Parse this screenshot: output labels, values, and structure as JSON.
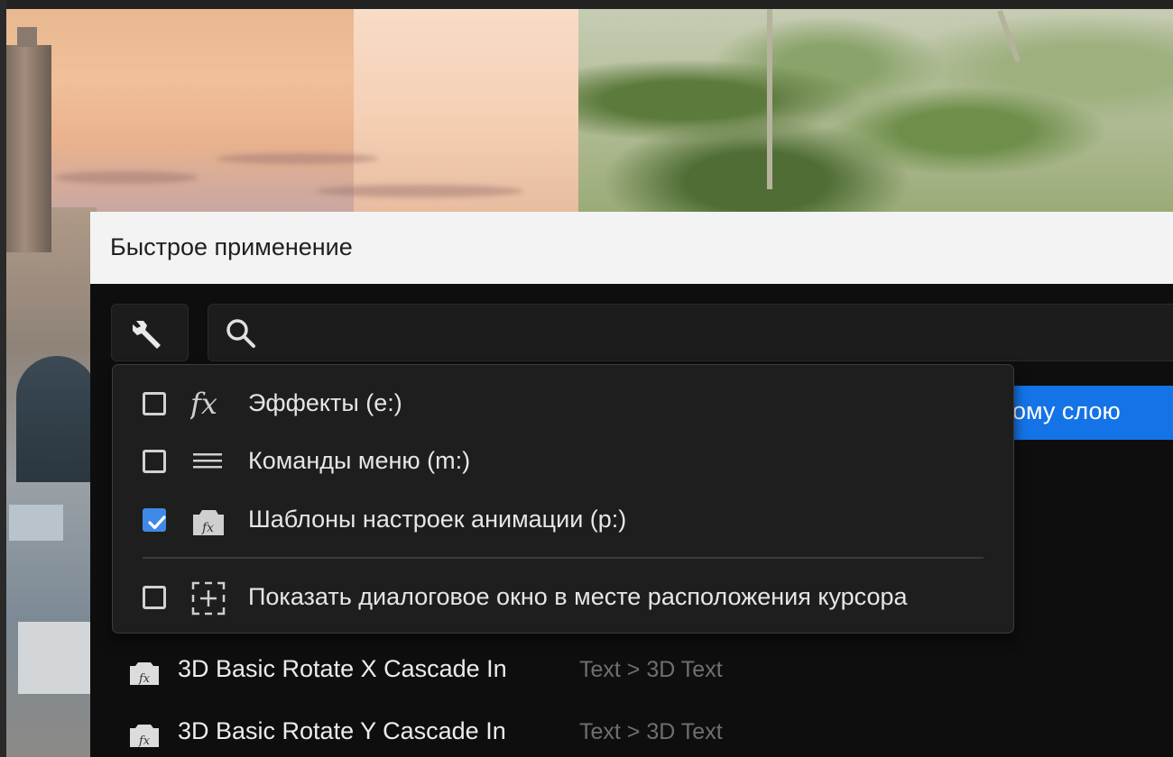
{
  "dialog": {
    "title": "Быстрое применение",
    "search": {
      "placeholder": "",
      "value": ""
    },
    "highlighted_row_text": "ому слою"
  },
  "filter_menu": {
    "items": [
      {
        "label": "Эффекты (e:)",
        "icon": "fx-icon",
        "checked": false
      },
      {
        "label": "Команды меню (m:)",
        "icon": "menu-lines-icon",
        "checked": false
      },
      {
        "label": "Шаблоны настроек анимации (p:)",
        "icon": "animation-preset-icon",
        "checked": true
      },
      {
        "label": "Показать диалоговое окно в месте расположения курсора",
        "icon": "cursor-position-icon",
        "checked": false
      }
    ]
  },
  "results": [
    {
      "name": "3D Basic Rotate X Cascade In",
      "path": "Text > 3D Text",
      "icon": "animation-preset-icon"
    },
    {
      "name": "3D Basic Rotate Y Cascade In",
      "path": "Text > 3D Text",
      "icon": "animation-preset-icon"
    }
  ],
  "colors": {
    "accent": "#1473e6",
    "checkbox_checked": "#3f8ae6",
    "dialog_bg": "#0e0e0e",
    "menu_bg": "#1e1e1e",
    "titlebar_bg": "#f3f3f3"
  }
}
